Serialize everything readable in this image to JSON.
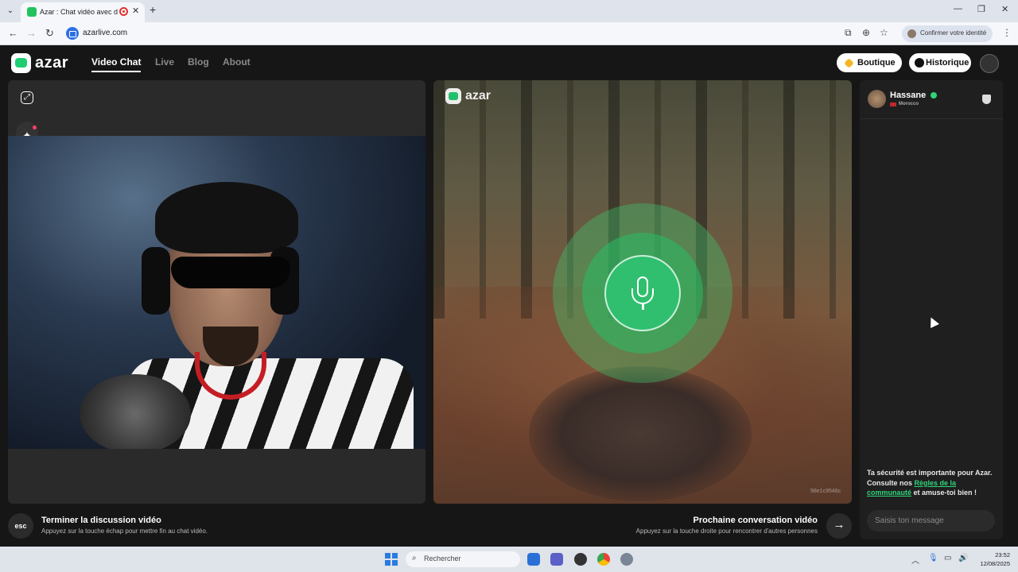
{
  "browser": {
    "tab_title": "Azar : Chat vidéo avec de n",
    "tab_close": "✕",
    "new_tab": "+",
    "url": "azarlive.com",
    "identity_label": "Confirmer votre identité",
    "icons": [
      "back-icon",
      "forward-icon",
      "reload-icon",
      "cast-icon",
      "zoom-icon",
      "star-icon",
      "menu-dots-icon"
    ]
  },
  "header": {
    "logo_text": "azar",
    "nav": [
      "Video Chat",
      "Live",
      "Blog",
      "About"
    ],
    "active_nav": "Video Chat",
    "shop_label": "Boutique",
    "history_label": "Historique",
    "accent_color": "#1fce73"
  },
  "remote": {
    "logo_text": "azar",
    "video_id": "98e1c9546c"
  },
  "chat": {
    "partner_name": "Hassane",
    "partner_country": "Morocco",
    "safety_text_1": "Ta sécurité est importante pour Azar. Consulte nos ",
    "safety_link": "Règles de la communauté",
    "safety_text_2": " et amuse-toi bien !",
    "input_placeholder": "Saisis ton message"
  },
  "actions": {
    "esc_label": "esc",
    "end_title": "Terminer la discussion vidéo",
    "end_subtitle": "Appuyez sur la touche échap pour mettre fin au chat vidéo.",
    "next_title": "Prochaine conversation vidéo",
    "next_subtitle": "Appuyez sur la touche droite pour rencontrer d'autres personnes",
    "next_arrow": "→"
  },
  "taskbar": {
    "search_label": "Rechercher",
    "time": "23:52",
    "date": "12/08/2025"
  }
}
